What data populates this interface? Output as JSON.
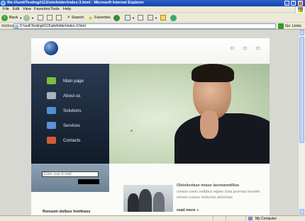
{
  "window": {
    "title": "file:///unit/Testing/t113/sitefolder/index-3.html - Microsoft Internet Explorer"
  },
  "menu": [
    "File",
    "Edit",
    "View",
    "Favorites",
    "Tools",
    "Help"
  ],
  "toolbar": {
    "back_label": "Back",
    "search_label": "Search",
    "favorites_label": "Favorites"
  },
  "address": {
    "label": "Address",
    "value": "D:\\unit\\Testing\\t113\\sitefolder\\index-3.html",
    "go_label": "Go",
    "links_label": "Links"
  },
  "site": {
    "nav": [
      {
        "label": "Main page",
        "icon": "green-star-icon",
        "color": "#7bbf3a"
      },
      {
        "label": "About us",
        "icon": "document-icon",
        "color": "#a8b3bd"
      },
      {
        "label": "Solutions",
        "icon": "blue-cube-icon",
        "color": "#4f8fd6"
      },
      {
        "label": "Services",
        "icon": "blue-grid-icon",
        "color": "#5b92d8"
      },
      {
        "label": "Contacts",
        "icon": "envelope-icon",
        "color": "#d45a3a"
      }
    ],
    "email_placeholder": "Enter your E-mail",
    "left_heading": "Renuum dolbus hretfease",
    "article": {
      "title": "Oleiekertase miase lacneanntillus",
      "body": "umase soeiu notbbus etgnio iciea jesertas leraeim minum cursus neductus atocenas",
      "read_more": "read more »"
    }
  },
  "status": {
    "zone": "My Computer"
  },
  "colors": {
    "sidebar_top": "#2a3b52",
    "sidebar_bottom": "#111b29",
    "hero_bg": "#c6d6b7",
    "email_panel": "#8ea2b5",
    "accent_text": "#4a5640"
  }
}
